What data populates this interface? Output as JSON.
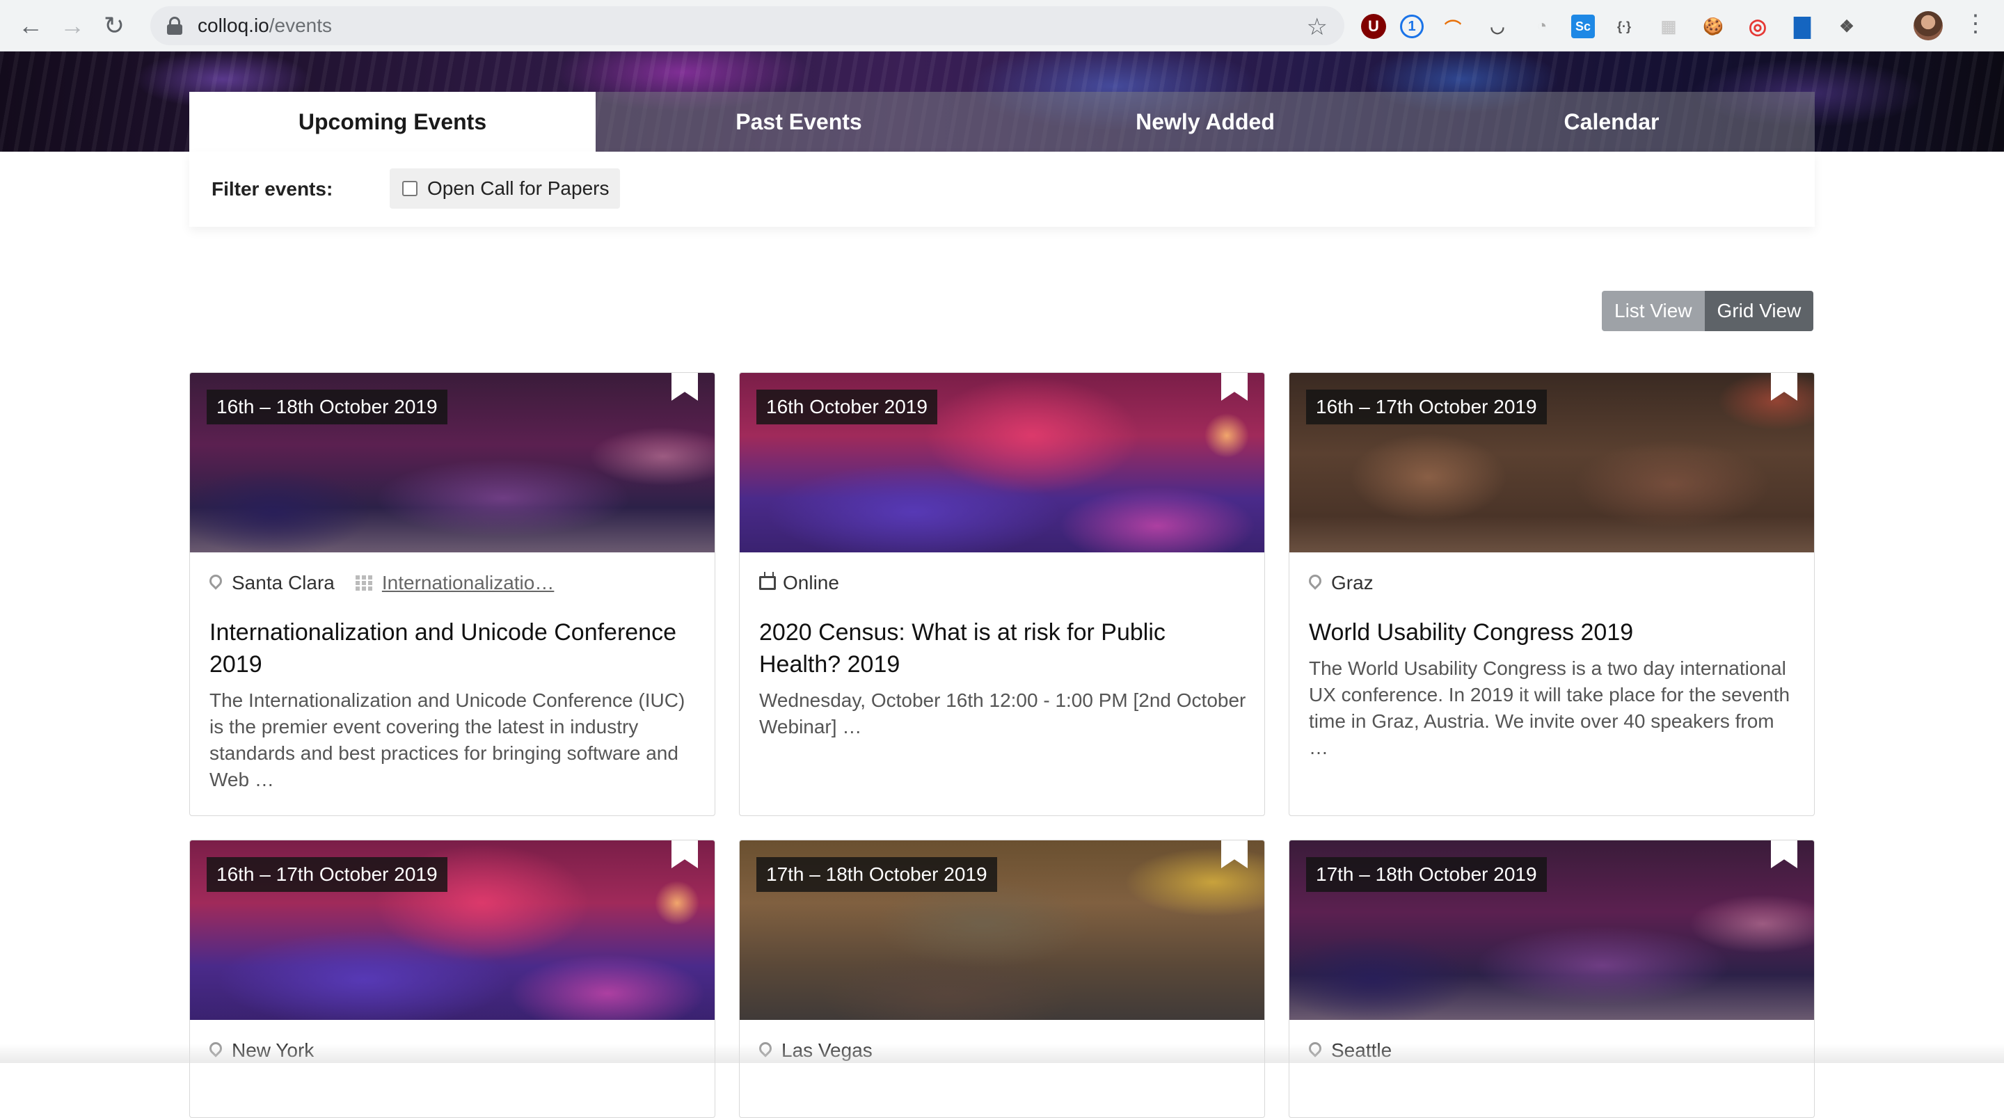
{
  "browser": {
    "url_host": "colloq.io",
    "url_path": "/events",
    "extensions": [
      "ublock-icon",
      "onepassword-icon",
      "rainbow-icon",
      "pocket-icon",
      "timer-icon",
      "sc-icon",
      "code-icon",
      "blank-icon",
      "cookie-icon",
      "ring-icon",
      "book-icon",
      "dropbox-icon"
    ],
    "extension_glyphs": [
      "U",
      "1",
      "⌒",
      "◡",
      "◔",
      "Sc",
      "{·}",
      "▦",
      "🍪",
      "◎",
      "▇",
      "❖"
    ]
  },
  "tabs": [
    {
      "label": "Upcoming Events",
      "active": true
    },
    {
      "label": "Past Events",
      "active": false
    },
    {
      "label": "Newly Added",
      "active": false
    },
    {
      "label": "Calendar",
      "active": false
    }
  ],
  "filter": {
    "label": "Filter events:",
    "cfp_label": "Open Call for Papers",
    "cfp_checked": false
  },
  "view_toggle": {
    "list_label": "List View",
    "grid_label": "Grid View",
    "selected": "Grid View"
  },
  "events": [
    {
      "date": "16th – 18th October 2019",
      "location": "Santa Clara",
      "topic": "Internationalizatio…",
      "title": "Internationalization and Unicode Conference 2019",
      "description": "The Internationalization and Unicode Conference (IUC) is the premier event covering the latest in industry standards and best practices for bringing software and Web …"
    },
    {
      "date": "16th October 2019",
      "location": "Online",
      "title": "2020 Census: What is at risk for Public Health? 2019",
      "description": "Wednesday, October 16th 12:00 - 1:00 PM [2nd October Webinar] …"
    },
    {
      "date": "16th – 17th October 2019",
      "location": "Graz",
      "title": "World Usability Congress 2019",
      "description": "The World Usability Congress is a two day international UX conference. In 2019 it will take place for the seventh time in Graz, Austria. We invite over 40 speakers from …"
    },
    {
      "date": "16th – 17th October 2019",
      "location": "New York"
    },
    {
      "date": "17th – 18th October 2019",
      "location": "Las Vegas"
    },
    {
      "date": "17th – 18th October 2019",
      "location": "Seattle"
    }
  ]
}
